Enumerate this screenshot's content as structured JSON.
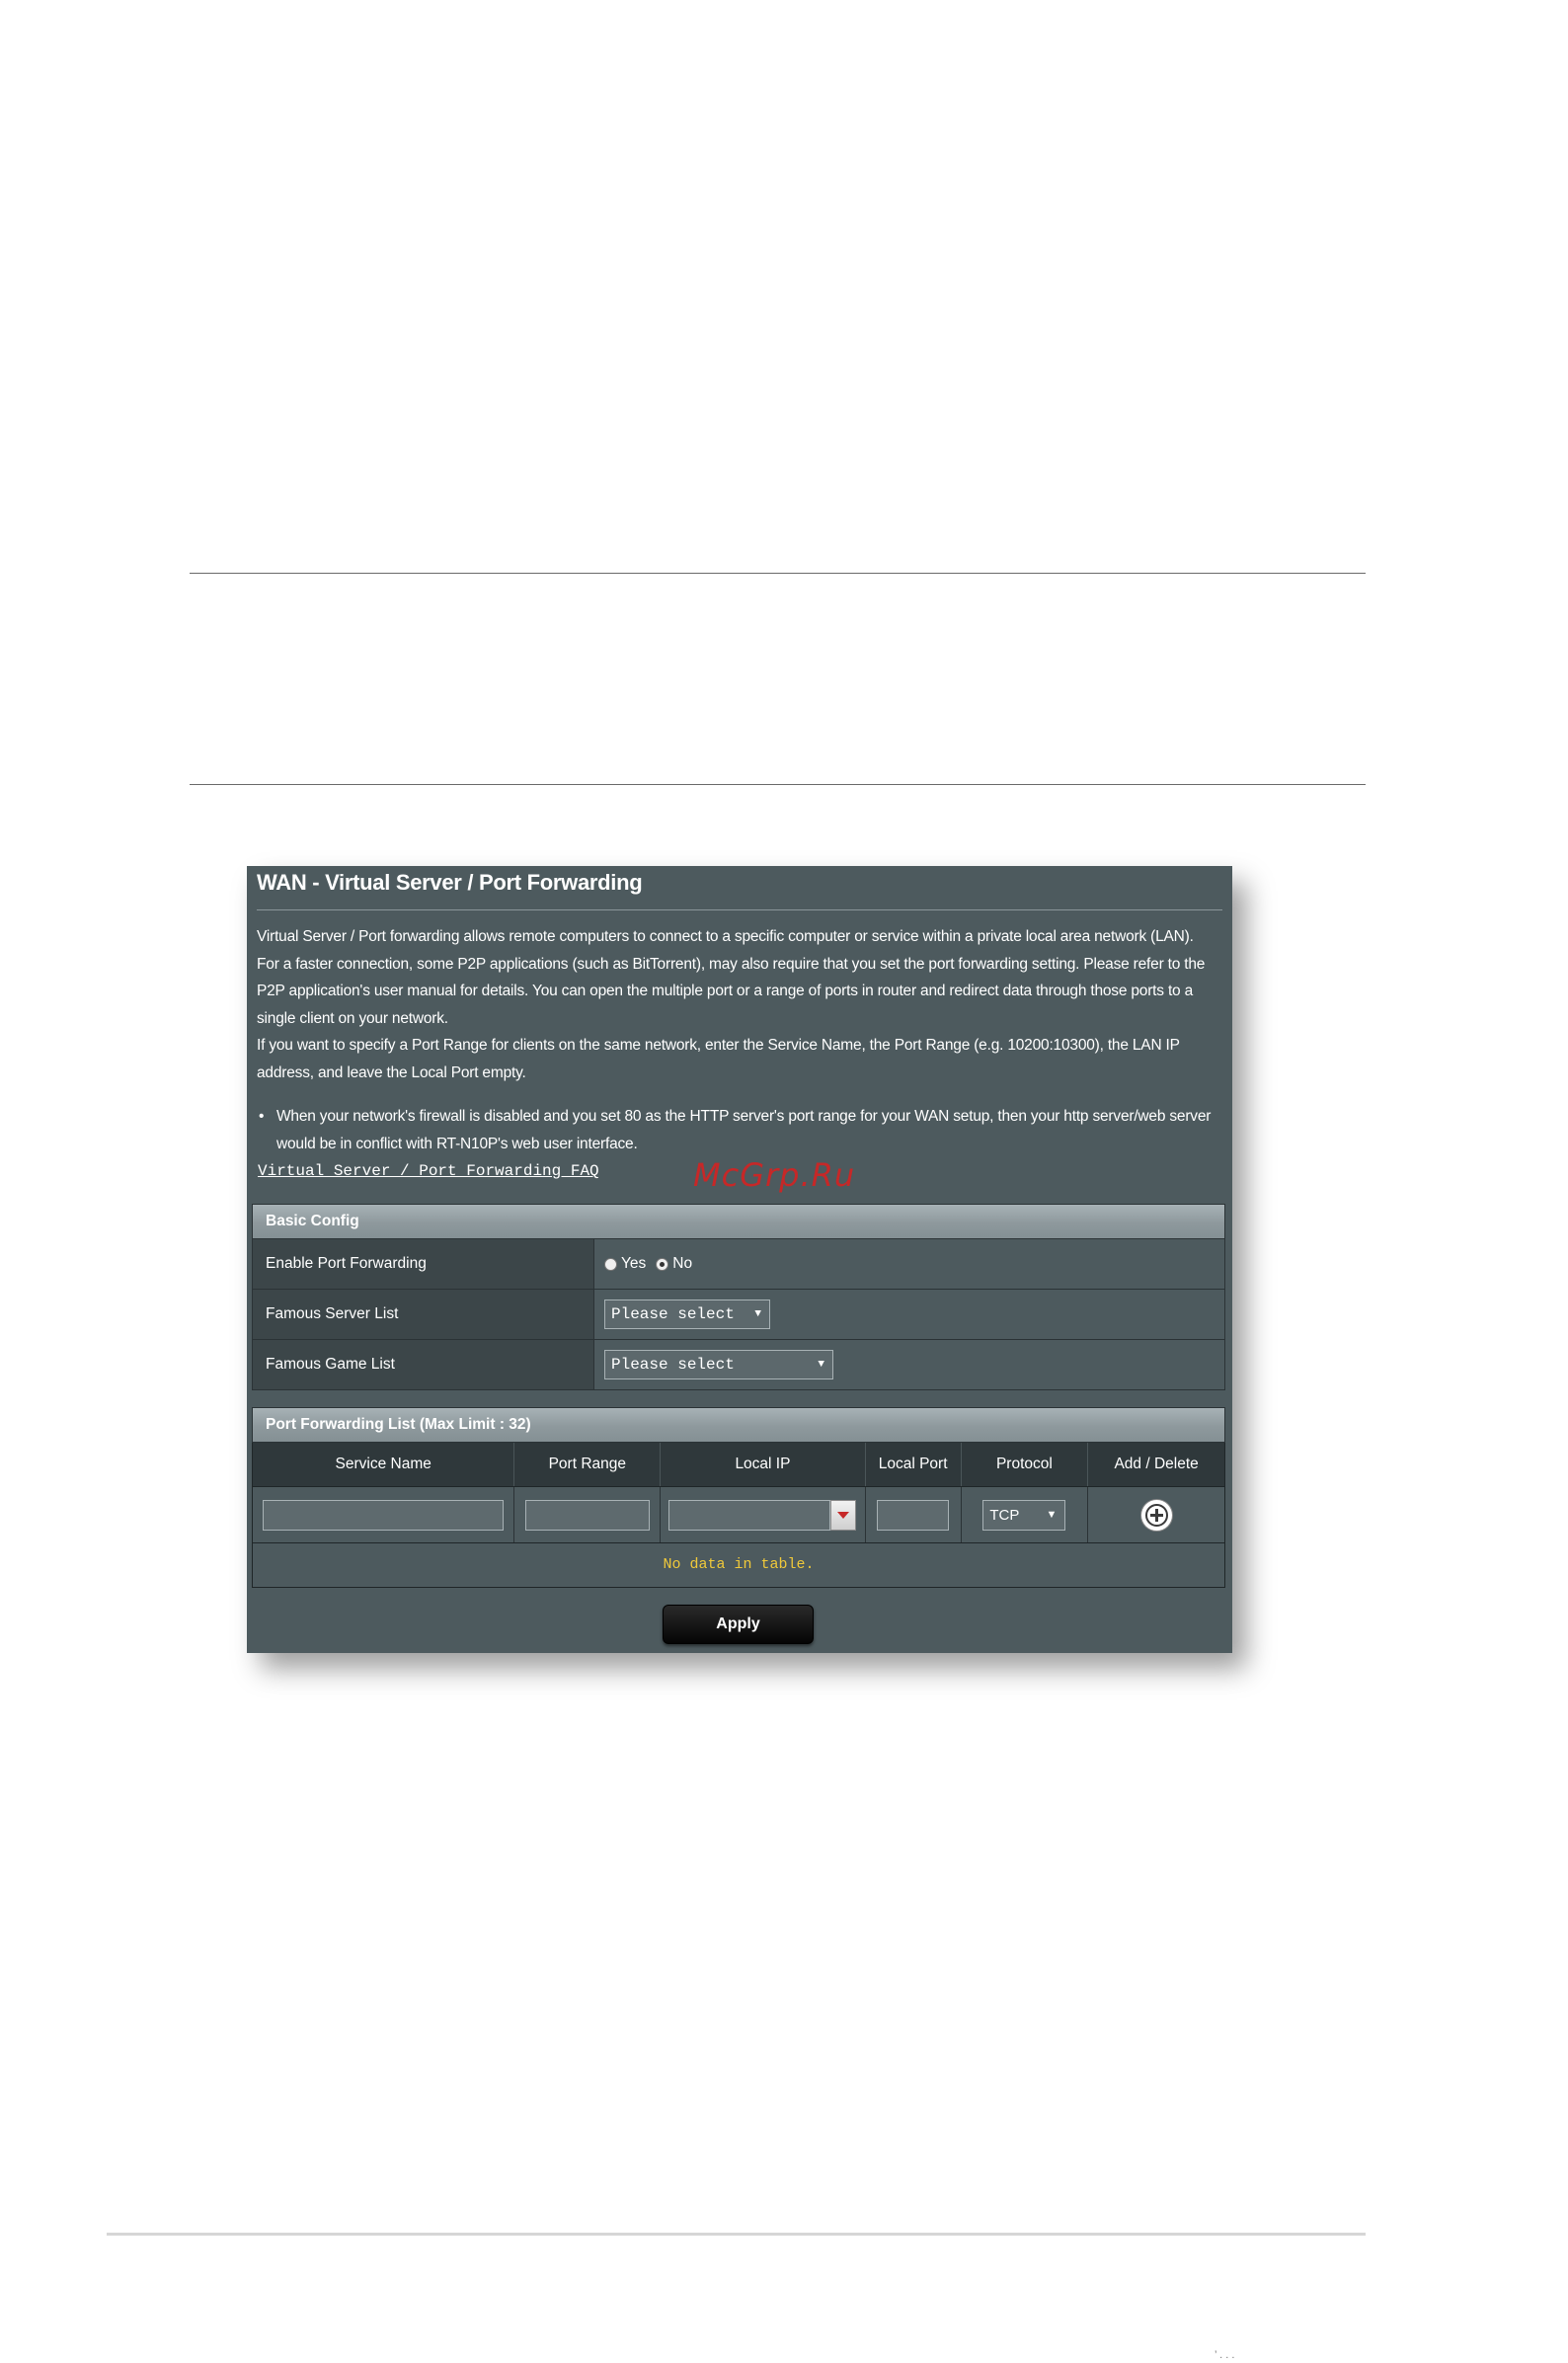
{
  "panel": {
    "title": "WAN - Virtual Server / Port Forwarding",
    "description": [
      "Virtual Server / Port forwarding allows remote computers to connect to a specific computer or service within a private local area network (LAN). For a faster connection, some P2P applications (such as BitTorrent), may also require that you set the port forwarding setting. Please refer to the P2P application's user manual for details. You can open the multiple port or a range of ports in router and redirect data through those ports to a single client on your network.",
      "If you want to specify a Port Range for clients on the same network, enter the Service Name, the Port Range (e.g. 10200:10300), the LAN IP address, and leave the Local Port empty."
    ],
    "bullet": "When your network's firewall is disabled and you set 80 as the HTTP server's port range for your WAN setup, then your http server/web server would be in conflict with RT-N10P's web user interface.",
    "faq_link": "Virtual Server / Port Forwarding FAQ",
    "watermark": "McGrp.Ru"
  },
  "basic_config": {
    "header": "Basic Config",
    "enable_label": "Enable Port Forwarding",
    "yes_label": "Yes",
    "no_label": "No",
    "selected": "No",
    "famous_server_label": "Famous Server List",
    "famous_server_value": "Please select",
    "famous_game_label": "Famous Game List",
    "famous_game_value": "Please select"
  },
  "port_forwarding_list": {
    "header": "Port Forwarding List (Max Limit : 32)",
    "columns": [
      "Service Name",
      "Port Range",
      "Local IP",
      "Local Port",
      "Protocol",
      "Add / Delete"
    ],
    "protocol_value": "TCP",
    "empty_message": "No data in table."
  },
  "apply_label": "Apply",
  "footer_text": "’ . . ."
}
